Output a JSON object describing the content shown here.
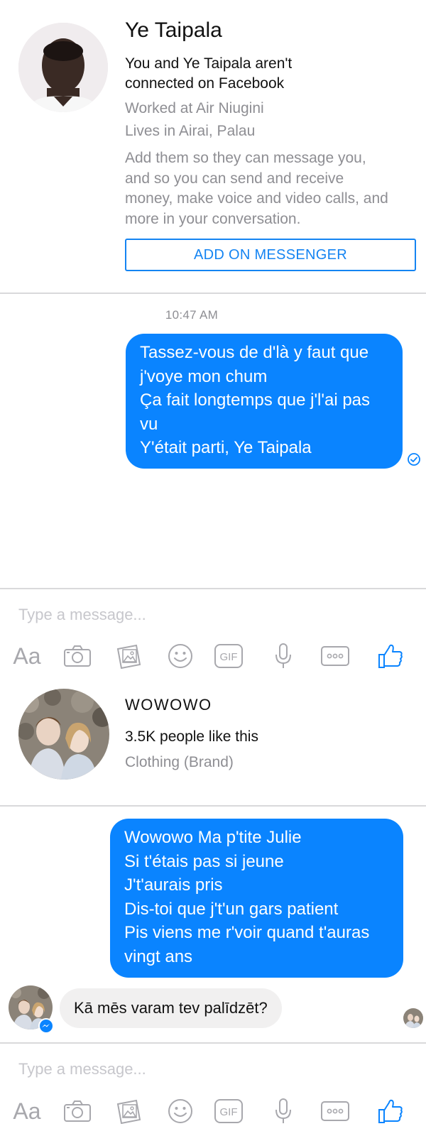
{
  "profile": {
    "name": "Ye Taipala",
    "connection_line1": "You and Ye Taipala aren't",
    "connection_line2": "connected on Facebook",
    "work": "Worked at Air Niugini",
    "lives": "Lives in Airai, Palau",
    "description": [
      "Add them so they can message you,",
      "and so you can send and receive",
      "money, make voice and video calls, and",
      "more in your conversation."
    ],
    "add_button": "ADD ON MESSENGER"
  },
  "conversation1": {
    "timestamp": "10:47 AM",
    "message_lines": [
      "Tassez-vous de d'là y faut que",
      "j'voye mon chum",
      "Ça fait longtemps que j'l'ai pas",
      "vu",
      "Y'était parti, Ye Taipala"
    ]
  },
  "composer": {
    "placeholder": "Type a message...",
    "aa_label": "Aa",
    "icons": [
      "camera-icon",
      "photo-gallery-icon",
      "emoji-icon",
      "gif-icon",
      "microphone-icon",
      "more-icon",
      "like-icon"
    ]
  },
  "page_profile": {
    "name": "WOWOWO",
    "likes": "3.5K people like this",
    "category": "Clothing (Brand)"
  },
  "conversation2": {
    "outgoing_lines": [
      "Wowowo Ma p'tite Julie",
      "Si t'étais pas si jeune",
      "J't'aurais pris",
      "Dis-toi que j't'un gars patient",
      "Pis viens me r'voir quand t'auras",
      "vingt ans"
    ],
    "incoming_message": "Kā mēs varam tev palīdzēt?"
  },
  "colors": {
    "accent": "#0a84ff",
    "button_border": "#1484f2",
    "secondary_text": "#8e8e93",
    "incoming_bubble": "#f1f0f0"
  }
}
